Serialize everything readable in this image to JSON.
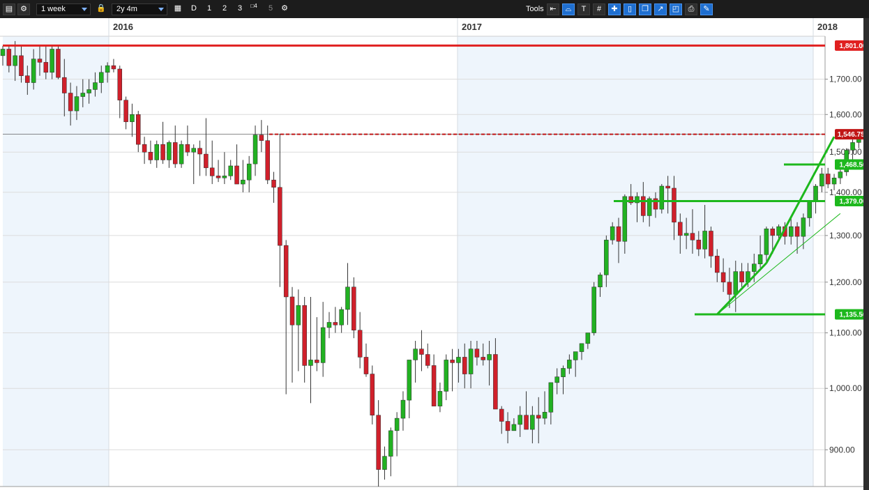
{
  "toolbar": {
    "interval": "1 week",
    "range": "2y 4m",
    "buttons": [
      "D",
      "1",
      "2",
      "3",
      "4",
      "5"
    ],
    "tools_label": "Tools"
  },
  "colors": {
    "up": "#22b122",
    "down": "#d0202b",
    "resistance": "#e02020",
    "support": "#1db81d",
    "current_price": "#c01616",
    "axis_text": "#333333"
  },
  "chart_data": {
    "type": "candlestick",
    "interval": "weekly",
    "scale": "log",
    "x_labels": [
      "2016",
      "2017",
      "2018"
    ],
    "y_ticks": [
      900,
      1000,
      1100,
      1200,
      1300,
      1400,
      1500,
      1600,
      1700
    ],
    "y_tick_labels": [
      "900.00",
      "1,000.00",
      "1,100.00",
      "1,200.00",
      "1,300.00",
      "1,400.00",
      "1,500.00",
      "1,600.00",
      "1,700.00"
    ],
    "ylim": [
      845,
      1830
    ],
    "grid": true,
    "candles": [
      [
        1770,
        1800,
        1740,
        1790
      ],
      [
        1790,
        1800,
        1720,
        1740
      ],
      [
        1740,
        1815,
        1695,
        1770
      ],
      [
        1770,
        1800,
        1690,
        1710
      ],
      [
        1710,
        1740,
        1655,
        1690
      ],
      [
        1690,
        1790,
        1670,
        1760
      ],
      [
        1760,
        1800,
        1710,
        1750
      ],
      [
        1750,
        1800,
        1700,
        1720
      ],
      [
        1720,
        1800,
        1700,
        1790
      ],
      [
        1790,
        1800,
        1700,
        1705
      ],
      [
        1705,
        1760,
        1595,
        1660
      ],
      [
        1660,
        1690,
        1570,
        1610
      ],
      [
        1610,
        1680,
        1585,
        1650
      ],
      [
        1650,
        1700,
        1620,
        1660
      ],
      [
        1660,
        1700,
        1630,
        1670
      ],
      [
        1670,
        1720,
        1650,
        1690
      ],
      [
        1690,
        1740,
        1660,
        1720
      ],
      [
        1720,
        1750,
        1690,
        1740
      ],
      [
        1740,
        1760,
        1720,
        1730
      ],
      [
        1730,
        1740,
        1590,
        1640
      ],
      [
        1640,
        1650,
        1560,
        1580
      ],
      [
        1580,
        1630,
        1540,
        1600
      ],
      [
        1600,
        1610,
        1500,
        1520
      ],
      [
        1520,
        1540,
        1470,
        1500
      ],
      [
        1500,
        1530,
        1470,
        1480
      ],
      [
        1480,
        1530,
        1460,
        1520
      ],
      [
        1520,
        1580,
        1470,
        1480
      ],
      [
        1480,
        1530,
        1460,
        1525
      ],
      [
        1525,
        1570,
        1460,
        1470
      ],
      [
        1470,
        1530,
        1460,
        1520
      ],
      [
        1520,
        1570,
        1490,
        1500
      ],
      [
        1500,
        1520,
        1420,
        1510
      ],
      [
        1510,
        1530,
        1440,
        1495
      ],
      [
        1495,
        1590,
        1440,
        1460
      ],
      [
        1460,
        1530,
        1420,
        1440
      ],
      [
        1440,
        1480,
        1425,
        1435
      ],
      [
        1435,
        1500,
        1420,
        1440
      ],
      [
        1440,
        1480,
        1430,
        1465
      ],
      [
        1465,
        1520,
        1430,
        1420
      ],
      [
        1420,
        1480,
        1400,
        1430
      ],
      [
        1430,
        1490,
        1400,
        1470
      ],
      [
        1470,
        1570,
        1440,
        1545
      ],
      [
        1545,
        1585,
        1500,
        1530
      ],
      [
        1530,
        1570,
        1420,
        1430
      ],
      [
        1430,
        1450,
        1375,
        1412
      ],
      [
        1412,
        1548,
        1190,
        1278
      ],
      [
        1278,
        1290,
        990,
        1170
      ],
      [
        1170,
        1190,
        1010,
        1115
      ],
      [
        1115,
        1185,
        1030,
        1153
      ],
      [
        1153,
        1170,
        1010,
        1040
      ],
      [
        1040,
        1170,
        975,
        1050
      ],
      [
        1050,
        1130,
        1030,
        1045
      ],
      [
        1045,
        1160,
        1020,
        1110
      ],
      [
        1110,
        1140,
        1090,
        1120
      ],
      [
        1120,
        1150,
        1100,
        1115
      ],
      [
        1115,
        1150,
        1100,
        1145
      ],
      [
        1145,
        1240,
        1115,
        1190
      ],
      [
        1190,
        1210,
        1090,
        1105
      ],
      [
        1105,
        1140,
        1035,
        1055
      ],
      [
        1055,
        1080,
        1020,
        1025
      ],
      [
        1025,
        1040,
        940,
        955
      ],
      [
        955,
        980,
        845,
        870
      ],
      [
        870,
        905,
        855,
        890
      ],
      [
        890,
        935,
        860,
        930
      ],
      [
        930,
        960,
        890,
        950
      ],
      [
        950,
        995,
        930,
        980
      ],
      [
        980,
        1050,
        950,
        1050
      ],
      [
        1050,
        1085,
        1010,
        1070
      ],
      [
        1070,
        1105,
        1030,
        1060
      ],
      [
        1060,
        1080,
        1035,
        1040
      ],
      [
        1040,
        1060,
        970,
        970
      ],
      [
        970,
        1010,
        960,
        995
      ],
      [
        995,
        1060,
        980,
        1050
      ],
      [
        1050,
        1070,
        995,
        1045
      ],
      [
        1045,
        1070,
        1010,
        1055
      ],
      [
        1055,
        1080,
        1000,
        1025
      ],
      [
        1025,
        1085,
        1000,
        1070
      ],
      [
        1070,
        1085,
        1040,
        1055
      ],
      [
        1055,
        1080,
        1040,
        1050
      ],
      [
        1050,
        1085,
        1005,
        1060
      ],
      [
        1060,
        1090,
        970,
        965
      ],
      [
        965,
        970,
        925,
        945
      ],
      [
        945,
        960,
        910,
        930
      ],
      [
        930,
        950,
        930,
        940
      ],
      [
        940,
        970,
        920,
        955
      ],
      [
        955,
        995,
        935,
        932
      ],
      [
        932,
        970,
        910,
        955
      ],
      [
        955,
        985,
        910,
        950
      ],
      [
        950,
        995,
        940,
        960
      ],
      [
        960,
        1010,
        940,
        1010
      ],
      [
        1010,
        1035,
        990,
        1020
      ],
      [
        1020,
        1040,
        990,
        1035
      ],
      [
        1035,
        1060,
        1025,
        1050
      ],
      [
        1050,
        1060,
        1020,
        1065
      ],
      [
        1065,
        1080,
        1050,
        1080
      ],
      [
        1080,
        1090,
        1070,
        1100
      ],
      [
        1100,
        1200,
        1095,
        1190
      ],
      [
        1190,
        1220,
        1170,
        1215
      ],
      [
        1215,
        1300,
        1190,
        1290
      ],
      [
        1290,
        1330,
        1280,
        1320
      ],
      [
        1320,
        1340,
        1240,
        1287
      ],
      [
        1287,
        1395,
        1260,
        1390
      ],
      [
        1390,
        1420,
        1370,
        1375
      ],
      [
        1375,
        1400,
        1330,
        1390
      ],
      [
        1390,
        1425,
        1330,
        1345
      ],
      [
        1345,
        1390,
        1320,
        1385
      ],
      [
        1385,
        1400,
        1340,
        1360
      ],
      [
        1360,
        1420,
        1350,
        1415
      ],
      [
        1415,
        1440,
        1350,
        1410
      ],
      [
        1410,
        1440,
        1290,
        1330
      ],
      [
        1330,
        1350,
        1260,
        1300
      ],
      [
        1300,
        1340,
        1270,
        1305
      ],
      [
        1305,
        1360,
        1260,
        1290
      ],
      [
        1290,
        1310,
        1255,
        1270
      ],
      [
        1270,
        1370,
        1250,
        1310
      ],
      [
        1310,
        1320,
        1230,
        1255
      ],
      [
        1255,
        1270,
        1200,
        1220
      ],
      [
        1220,
        1250,
        1180,
        1200
      ],
      [
        1200,
        1230,
        1148,
        1175
      ],
      [
        1175,
        1245,
        1140,
        1222
      ],
      [
        1222,
        1240,
        1190,
        1200
      ],
      [
        1200,
        1240,
        1190,
        1222
      ],
      [
        1222,
        1260,
        1200,
        1238
      ],
      [
        1238,
        1300,
        1230,
        1258
      ],
      [
        1258,
        1320,
        1240,
        1315
      ],
      [
        1315,
        1320,
        1260,
        1300
      ],
      [
        1300,
        1325,
        1290,
        1320
      ],
      [
        1320,
        1330,
        1280,
        1298
      ],
      [
        1298,
        1340,
        1280,
        1320
      ],
      [
        1320,
        1330,
        1260,
        1298
      ],
      [
        1298,
        1350,
        1270,
        1340
      ],
      [
        1340,
        1380,
        1320,
        1380
      ],
      [
        1380,
        1420,
        1350,
        1415
      ],
      [
        1415,
        1460,
        1400,
        1445
      ],
      [
        1445,
        1460,
        1410,
        1420
      ],
      [
        1420,
        1445,
        1405,
        1435
      ],
      [
        1435,
        1470,
        1420,
        1450
      ],
      [
        1450,
        1510,
        1440,
        1505
      ],
      [
        1505,
        1550,
        1480,
        1525
      ],
      [
        1525,
        1550,
        1510,
        1546.75
      ]
    ],
    "horizontal_lines": [
      {
        "value": 1801.0,
        "label": "1,801.00",
        "color": "#e02020",
        "style": "solid"
      },
      {
        "value": 1546.75,
        "label": "1,546.750",
        "color": "#c01616",
        "style": "dashed"
      },
      {
        "value": 1468.5,
        "label": "1,468.50",
        "color": "#1db81d",
        "style": "solid"
      },
      {
        "value": 1379.0,
        "label": "1,379.00",
        "color": "#1db81d",
        "style": "solid"
      },
      {
        "value": 1135.5,
        "label": "1,135.50",
        "color": "#1db81d",
        "style": "solid"
      }
    ],
    "trend_lines": [
      {
        "from": [
          116,
          1135.5
        ],
        "to": [
          124,
          1240
        ]
      },
      {
        "from": [
          124,
          1240
        ],
        "to": [
          135,
          1540
        ]
      },
      {
        "from": [
          116,
          1135.5
        ],
        "to": [
          136,
          1350
        ]
      }
    ]
  }
}
